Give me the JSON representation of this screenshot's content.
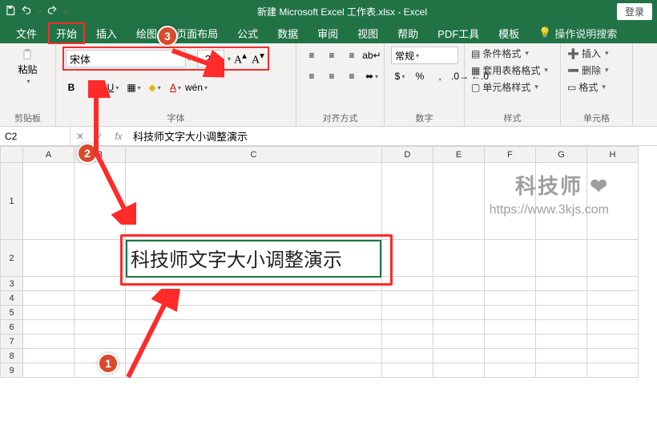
{
  "titlebar": {
    "title": "新建 Microsoft Excel 工作表.xlsx - Excel",
    "login": "登录"
  },
  "tabs": {
    "file": "文件",
    "home": "开始",
    "insert": "插入",
    "draw": "绘图",
    "layout": "页面布局",
    "formula": "公式",
    "data": "数据",
    "review": "审阅",
    "view": "视图",
    "help": "帮助",
    "pdf": "PDF工具",
    "template": "模板",
    "tell": "操作说明搜索"
  },
  "ribbon": {
    "clipboard": {
      "label": "剪贴板",
      "paste": "粘贴"
    },
    "font": {
      "label": "字体",
      "name": "宋体",
      "size": "20"
    },
    "align": {
      "label": "对齐方式"
    },
    "number": {
      "label": "数字",
      "fmt": "常规"
    },
    "styles": {
      "label": "样式",
      "cond": "条件格式",
      "tbl": "套用表格格式",
      "cell": "单元格样式"
    },
    "cells": {
      "label": "单元格",
      "ins": "插入",
      "del": "删除",
      "fmt": "格式"
    }
  },
  "fx": {
    "cellref": "C2",
    "formula": "科技师文字大小调整演示"
  },
  "columns": [
    "A",
    "B",
    "C",
    "D",
    "E",
    "F",
    "G",
    "H"
  ],
  "rows": [
    "1",
    "2",
    "3",
    "4",
    "5",
    "6",
    "7",
    "8",
    "9"
  ],
  "cell_c2": "科技师文字大小调整演示",
  "annot": {
    "n1": "1",
    "n2": "2",
    "n3": "3"
  },
  "watermark": {
    "line1": "科技师",
    "line2": "https://www.3kjs.com"
  },
  "colwidths": {
    "A": 64,
    "B": 64,
    "C": 320,
    "D": 64,
    "E": 64,
    "F": 64,
    "G": 64,
    "H": 64
  }
}
